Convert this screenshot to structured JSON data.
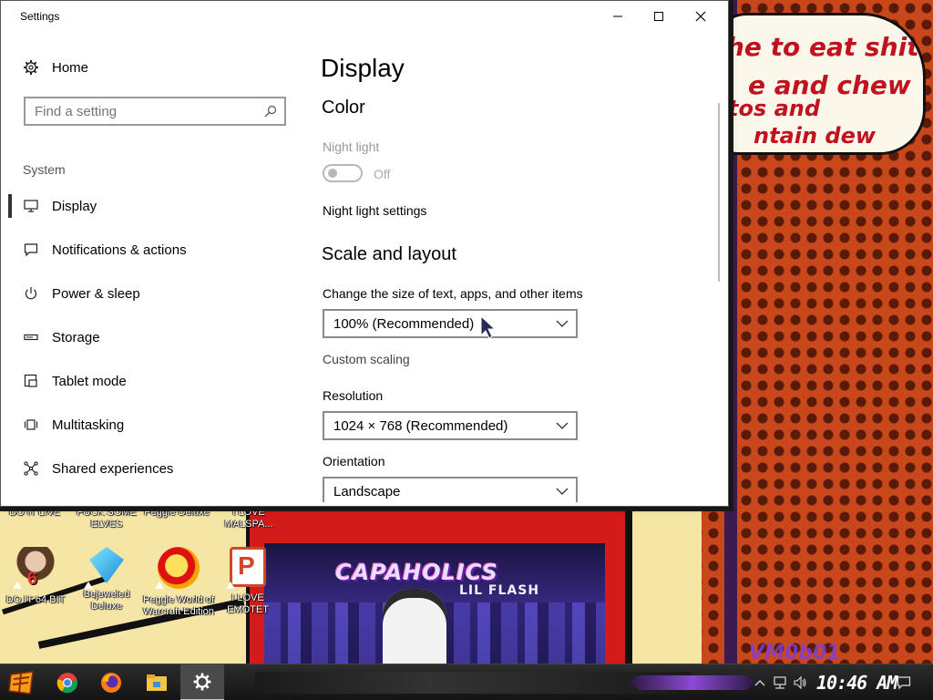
{
  "window": {
    "title": "Settings",
    "controls": {
      "minimize": "minimize",
      "maximize": "maximize",
      "close": "close"
    }
  },
  "nav": {
    "home_label": "Home",
    "search": {
      "placeholder": "Find a setting",
      "value": ""
    },
    "section_label": "System",
    "items": [
      {
        "label": "Display",
        "icon": "monitor-icon",
        "active": true
      },
      {
        "label": "Notifications & actions",
        "icon": "message-icon"
      },
      {
        "label": "Power & sleep",
        "icon": "power-icon"
      },
      {
        "label": "Storage",
        "icon": "storage-icon"
      },
      {
        "label": "Tablet mode",
        "icon": "tablet-mode-icon"
      },
      {
        "label": "Multitasking",
        "icon": "multitasking-icon"
      },
      {
        "label": "Shared experiences",
        "icon": "shared-experiences-icon"
      }
    ]
  },
  "content": {
    "page_title": "Display",
    "color_heading": "Color",
    "night_light_label": "Night light",
    "night_light_state": "Off",
    "night_light_settings_link": "Night light settings",
    "scale_heading": "Scale and layout",
    "scale_label": "Change the size of text, apps, and other items",
    "scale_value": "100% (Recommended)",
    "custom_scaling_link": "Custom scaling",
    "resolution_label": "Resolution",
    "resolution_value": "1024 × 768 (Recommended)",
    "orientation_label": "Orientation",
    "orientation_value": "Landscape"
  },
  "desktop": {
    "top_labels": [
      "DO IT LIVE",
      "FUCK SOME\nELVES",
      "Peggle Deluxe",
      "I LOVE\nMALSPA..."
    ],
    "icons": [
      {
        "label": "DO IT 64 BIT",
        "icon": "portrait-icon"
      },
      {
        "label": "Bejeweled\nDeluxe",
        "icon": "gem-icon"
      },
      {
        "label": "Peggle World of\nWarcraft Edition",
        "icon": "peggle-icon"
      },
      {
        "label": "I LOVE EMOTET",
        "icon": "powerpoint-icon"
      }
    ],
    "overlay_number": "6",
    "wallpaper_text": [
      "he to eat shit",
      "e and chew",
      "tos and",
      "ntain dew"
    ],
    "album": {
      "title": "CAPAHOLICS",
      "subtitle": "LIL FLASH"
    },
    "watermark": "VM0b01"
  },
  "taskbar": {
    "apps": [
      "start-icon",
      "chrome-icon",
      "firefox-icon",
      "file-explorer-icon",
      "settings-icon"
    ],
    "clock": "10:46 AM",
    "tray": [
      "chevron-up-icon",
      "network-icon",
      "volume-icon",
      "action-center-icon"
    ]
  },
  "colors": {
    "accent": "#000000",
    "wallpaper_orange": "#c8471b",
    "bubble_red": "#c1121f"
  }
}
